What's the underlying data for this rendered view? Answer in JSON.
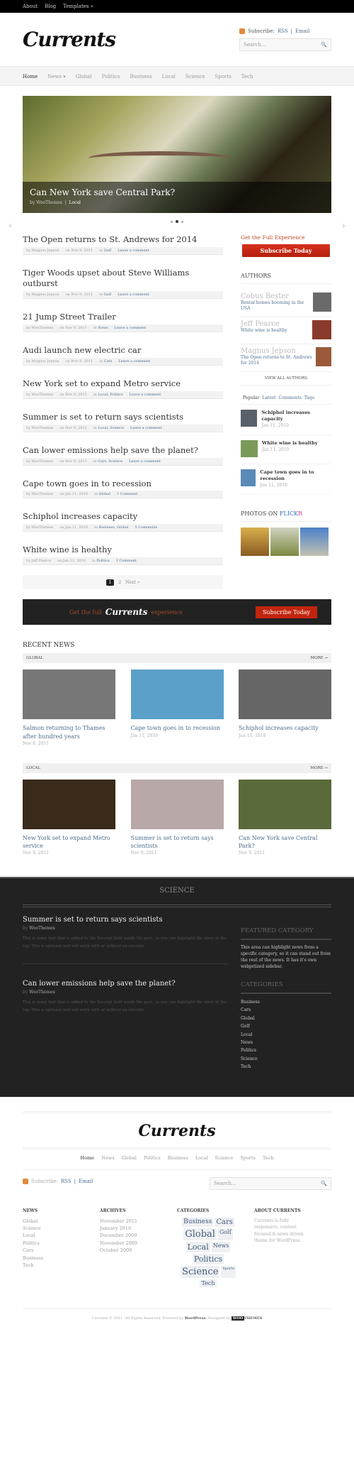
{
  "topbar": {
    "items": [
      "About",
      "Blog",
      "Templates »"
    ]
  },
  "header": {
    "logo": "Currents",
    "subscribe_label": "Subscribe:",
    "rss_label": "RSS",
    "sep": "|",
    "email_label": "Email",
    "search_placeholder": "Search..."
  },
  "nav": {
    "items": [
      "Home",
      "News ▾",
      "Global",
      "Politics",
      "Business",
      "Local",
      "Science",
      "Sports",
      "Tech"
    ]
  },
  "slider": {
    "title": "Can New York save Central Park?",
    "by": "by WooThemes",
    "category": "Local",
    "prev": "‹",
    "next": "›"
  },
  "posts": [
    {
      "title": "The Open returns to St. Andrews for 2014",
      "author": "by Magnus Jepson",
      "date": "on Nov 9, 2011",
      "in": "in",
      "cats": "Golf",
      "comments": "Leave a comment"
    },
    {
      "title": "Tiger Woods upset about Steve Williams outburst",
      "author": "by Magnus Jepson",
      "date": "on Nov 9, 2011",
      "in": "in",
      "cats": "Golf",
      "comments": "Leave a comment"
    },
    {
      "title": "21 Jump Street Trailer",
      "author": "by WooThemes",
      "date": "on Nov 9, 2011",
      "in": "in",
      "cats": "News",
      "comments": "Leave a comment"
    },
    {
      "title": "Audi launch new electric car",
      "author": "by Magnus Jepson",
      "date": "on Nov 9, 2011",
      "in": "in",
      "cats": "Cars",
      "comments": "Leave a comment"
    },
    {
      "title": "New York set to expand Metro service",
      "author": "by WooThemes",
      "date": "on Nov 9, 2011",
      "in": "in",
      "cats": "Local, Politics",
      "comments": "Leave a comment"
    },
    {
      "title": "Summer is set to return says scientists",
      "author": "by WooThemes",
      "date": "on Nov 9, 2011",
      "in": "in",
      "cats": "Local, Science",
      "comments": "Leave a comment"
    },
    {
      "title": "Can lower emissions help save the planet?",
      "author": "by WooThemes",
      "date": "on Nov 9, 2011",
      "in": "in",
      "cats": "Cars, Science",
      "comments": "Leave a comment"
    },
    {
      "title": "Cape town goes in to recession",
      "author": "by WooThemes",
      "date": "on Jan 11, 2010",
      "in": "in",
      "cats": "Global",
      "comments": "1 Comment"
    },
    {
      "title": "Schiphol increases capacity",
      "author": "by WooThemes",
      "date": "on Jan 11, 2010",
      "in": "in",
      "cats": "Business, Global",
      "comments": "5 Comments"
    },
    {
      "title": "White wine is healthy",
      "author": "by Jeff Pearce",
      "date": "on Jan 11, 2010",
      "in": "in",
      "cats": "Politics",
      "comments": "1 Comment"
    }
  ],
  "pagination": {
    "current": "1",
    "page2": "2",
    "next": "Next »"
  },
  "sidebar": {
    "getfull": "Get the Full Experience",
    "subscribe_btn": "Subscribe Today",
    "authors_title": "AUTHORS",
    "authors": [
      {
        "name": "Cobus Bester",
        "post": "Rental homes booming in the USA"
      },
      {
        "name": "Jeff Pearce",
        "post": "White wine is healthy"
      },
      {
        "name": "Magnus Jepson",
        "post": "The Open returns to St. Andrews for 2014"
      }
    ],
    "view_all": "VIEW ALL AUTHORS",
    "tabs": [
      "Popular",
      "Latest",
      "Comments",
      "Tags"
    ],
    "popular": [
      {
        "title": "Schiphol increases capacity",
        "date": "Jan 11, 2010"
      },
      {
        "title": "White wine is healthy",
        "date": "Jan 11, 2010"
      },
      {
        "title": "Cape town goes in to recession",
        "date": "Jan 11, 2010"
      }
    ],
    "flickr_title": "PHOTOS ON",
    "flickr_brand_a": "FLICK",
    "flickr_brand_b": "R"
  },
  "banner": {
    "pre": "Get the full",
    "logo": "Currents",
    "post": "experience",
    "btn": "Subscribe Today"
  },
  "recent": {
    "title": "RECENT NEWS",
    "more": "MORE →",
    "sections": [
      {
        "name": "GLOBAL",
        "items": [
          {
            "title": "Salmon returning to Thames after hundred years",
            "date": "Nov 9, 2011"
          },
          {
            "title": "Cape town goes in to recession",
            "date": "Jan 11, 2010"
          },
          {
            "title": "Schiphol increases capacity",
            "date": "Jan 11, 2010"
          }
        ]
      },
      {
        "name": "LOCAL",
        "items": [
          {
            "title": "New York set to expand Metro service",
            "date": "Nov 9, 2011"
          },
          {
            "title": "Summer is set to return says scientists",
            "date": "Nov 9, 2011"
          },
          {
            "title": "Can New York save Central Park?",
            "date": "Nov 9, 2011"
          }
        ]
      }
    ]
  },
  "science": {
    "title": "SCIENCE",
    "posts": [
      {
        "title": "Summer is set to return says scientists",
        "by": "by",
        "author": "WooThemes",
        "excerpt": "This is some text that is added to the Excerpt field inside the post, so you can highlight the story at the top. This is optional and will work with or without an excerpt."
      },
      {
        "title": "Can lower emissions help save the planet?",
        "by": "by",
        "author": "WooThemes",
        "excerpt": "This is some text that is added to the Excerpt field inside the post, so you can highlight the story at the top. This is optional and will work with or without an excerpt."
      }
    ],
    "featured_title": "FEATURED CATEGORY",
    "featured_text": "This area can highlight news from a specific category, so it can stand out from the rest of the news. It has it's own widgetized sidebar.",
    "categories_title": "CATEGORIES",
    "categories": [
      "Business",
      "Cars",
      "Global",
      "Golf",
      "Local",
      "News",
      "Politics",
      "Science",
      "Tech"
    ]
  },
  "footer": {
    "logo": "Currents",
    "nav": [
      "Home",
      "News",
      "Global",
      "Politics",
      "Business",
      "Local",
      "Science",
      "Sports",
      "Tech"
    ],
    "subscribe_label": "Subscribe:",
    "rss_label": "RSS",
    "email_label": "Email",
    "search_placeholder": "Search...",
    "news_title": "NEWS",
    "news": [
      "Global",
      "Science",
      "Local",
      "Politics",
      "Cars",
      "Business",
      "Tech"
    ],
    "archives_title": "ARCHIVES",
    "archives": [
      "November 2011",
      "January 2010",
      "December 2009",
      "November 2009",
      "October 2009"
    ],
    "categories_title": "CATEGORIES",
    "tags": [
      "Business",
      "Cars",
      "Global",
      "Golf",
      "Local",
      "News",
      "Politics",
      "Science",
      "Sports",
      "Tech"
    ],
    "about_title": "ABOUT CURRENTS",
    "about_text": "Currents is fully responsive, content focused & news driven theme for WordPress.",
    "copyright": "Currents © 2011. All Rights Reserved. Powered by",
    "wordpress": "WordPress",
    "designed_by": ". Designed by",
    "woo": "WOO",
    "themes": "THEMES"
  }
}
